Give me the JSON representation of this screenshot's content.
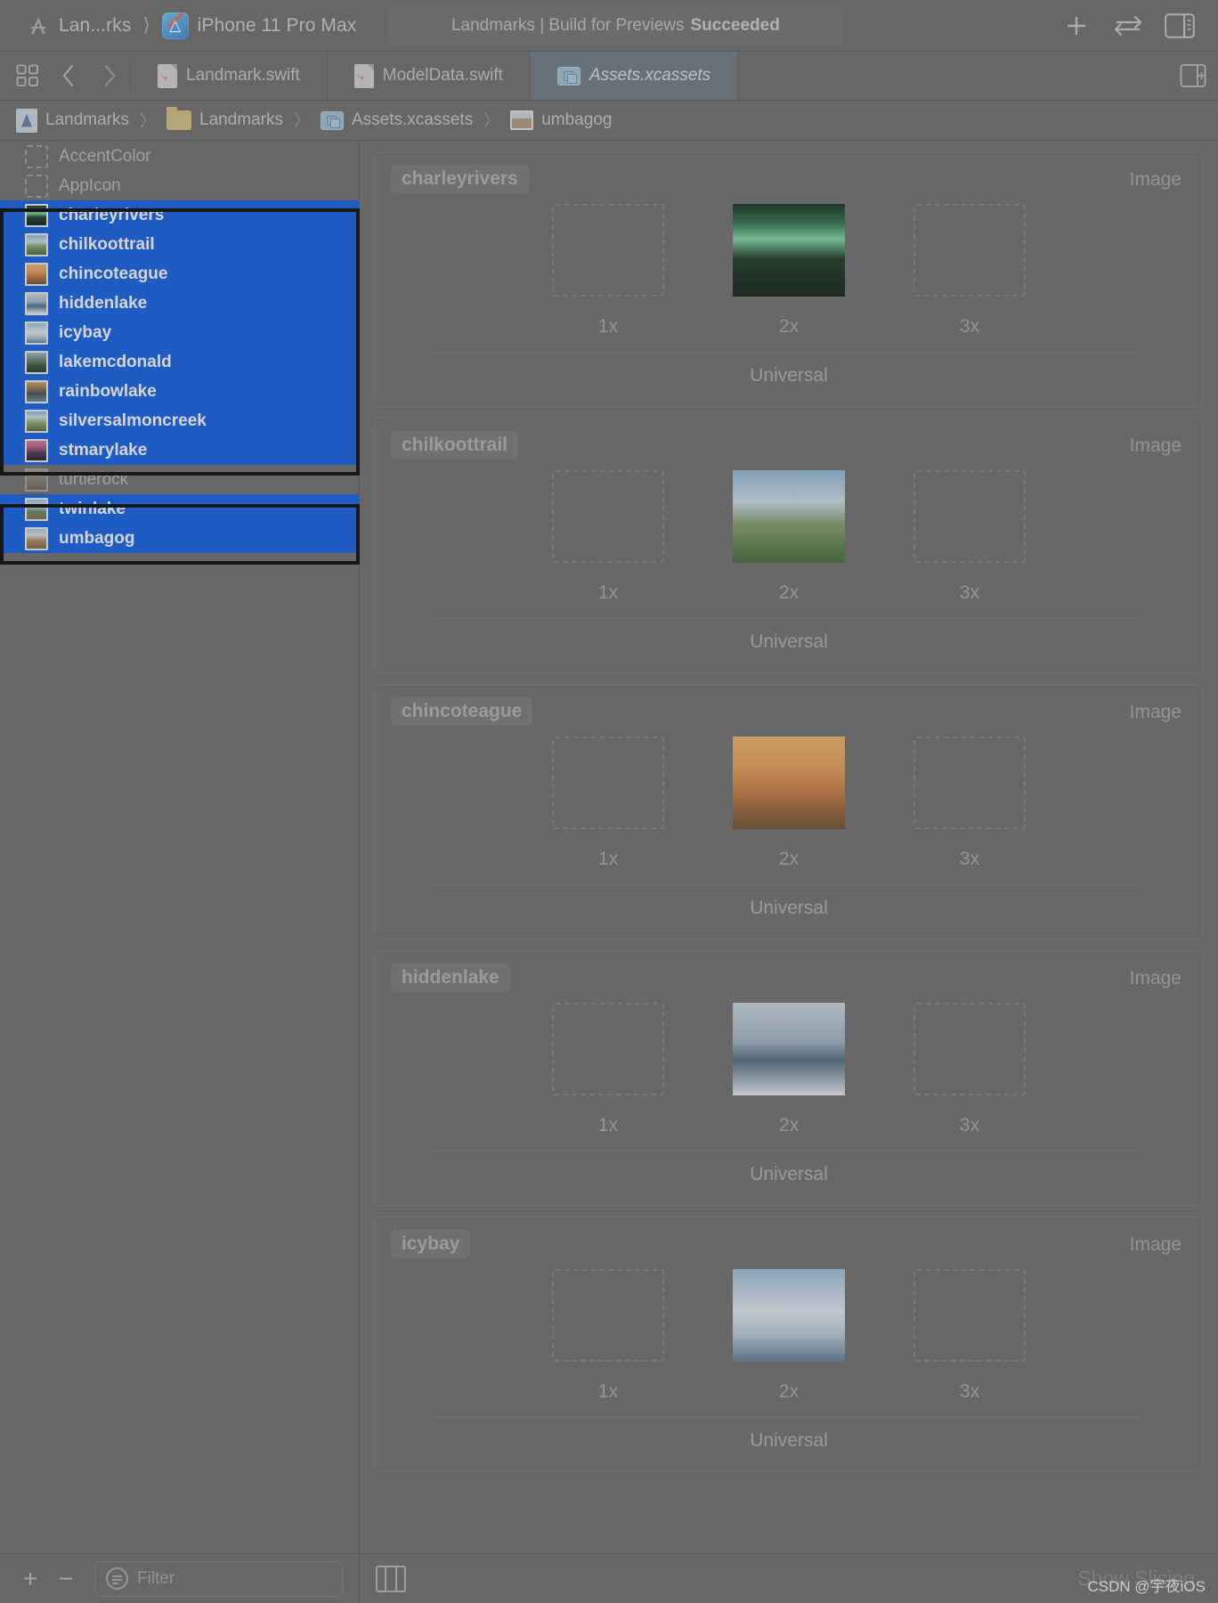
{
  "toolbar": {
    "scheme_name": "Lan...rks",
    "destination": "iPhone 11 Pro Max",
    "status_prefix": "Landmarks | Build for Previews",
    "status_result": "Succeeded",
    "add_icon": "plus-icon",
    "swap_icon": "swap-arrows-icon",
    "inspector_icon": "inspector-panel-icon"
  },
  "tabbar": {
    "grid_icon": "tab-grid-icon",
    "back_icon": "chevron-left-icon",
    "forward_icon": "chevron-right-icon",
    "add_tab_icon": "add-editor-icon",
    "tabs": [
      {
        "label": "Landmark.swift",
        "icon": "swift-file-icon",
        "active": false
      },
      {
        "label": "ModelData.swift",
        "icon": "swift-file-icon",
        "active": false
      },
      {
        "label": "Assets.xcassets",
        "icon": "xcassets-icon",
        "active": true
      }
    ]
  },
  "breadcrumb": {
    "items": [
      {
        "label": "Landmarks",
        "icon": "project-icon"
      },
      {
        "label": "Landmarks",
        "icon": "folder-icon"
      },
      {
        "label": "Assets.xcassets",
        "icon": "xcassets-icon"
      },
      {
        "label": "umbagog",
        "icon": "image-thumb-icon"
      }
    ],
    "separator": "〉"
  },
  "sidebar": {
    "items": [
      {
        "label": "AccentColor",
        "icon": "color-swatch-icon",
        "selected": false
      },
      {
        "label": "AppIcon",
        "icon": "color-swatch-icon",
        "selected": false
      },
      {
        "label": "charleyrivers",
        "icon": "image-thumb-icon",
        "selected": true
      },
      {
        "label": "chilkoottrail",
        "icon": "image-thumb-icon",
        "selected": true
      },
      {
        "label": "chincoteague",
        "icon": "image-thumb-icon",
        "selected": true
      },
      {
        "label": "hiddenlake",
        "icon": "image-thumb-icon",
        "selected": true
      },
      {
        "label": "icybay",
        "icon": "image-thumb-icon",
        "selected": true
      },
      {
        "label": "lakemcdonald",
        "icon": "image-thumb-icon",
        "selected": true
      },
      {
        "label": "rainbowlake",
        "icon": "image-thumb-icon",
        "selected": true
      },
      {
        "label": "silversalmoncreek",
        "icon": "image-thumb-icon",
        "selected": true
      },
      {
        "label": "stmarylake",
        "icon": "image-thumb-icon",
        "selected": true
      },
      {
        "label": "turtlerock",
        "icon": "image-thumb-icon",
        "selected": false
      },
      {
        "label": "twinlake",
        "icon": "image-thumb-icon",
        "selected": true
      },
      {
        "label": "umbagog",
        "icon": "image-thumb-icon",
        "selected": true
      }
    ],
    "footer": {
      "add_label": "+",
      "remove_label": "−",
      "filter_placeholder": "Filter",
      "filter_value": "",
      "filter_icon": "filter-icon"
    }
  },
  "detail": {
    "kind_label": "Image",
    "universal_label": "Universal",
    "scale_labels": [
      "1x",
      "2x",
      "3x"
    ],
    "groups": [
      {
        "name": "charleyrivers",
        "filled_scale": "2x"
      },
      {
        "name": "chilkoottrail",
        "filled_scale": "2x"
      },
      {
        "name": "chincoteague",
        "filled_scale": "2x"
      },
      {
        "name": "hiddenlake",
        "filled_scale": "2x"
      },
      {
        "name": "icybay",
        "filled_scale": "2x"
      }
    ],
    "footer": {
      "slicing_label": "Show Slicing",
      "slicing_icon": "slicing-icon"
    }
  },
  "colors": {
    "selection_blue": "#0a5ee8",
    "window_gray": "#6c6c6c",
    "active_tab": "#6e7a86",
    "outline_black": "#000000"
  },
  "watermark": "CSDN @宇夜iOS"
}
